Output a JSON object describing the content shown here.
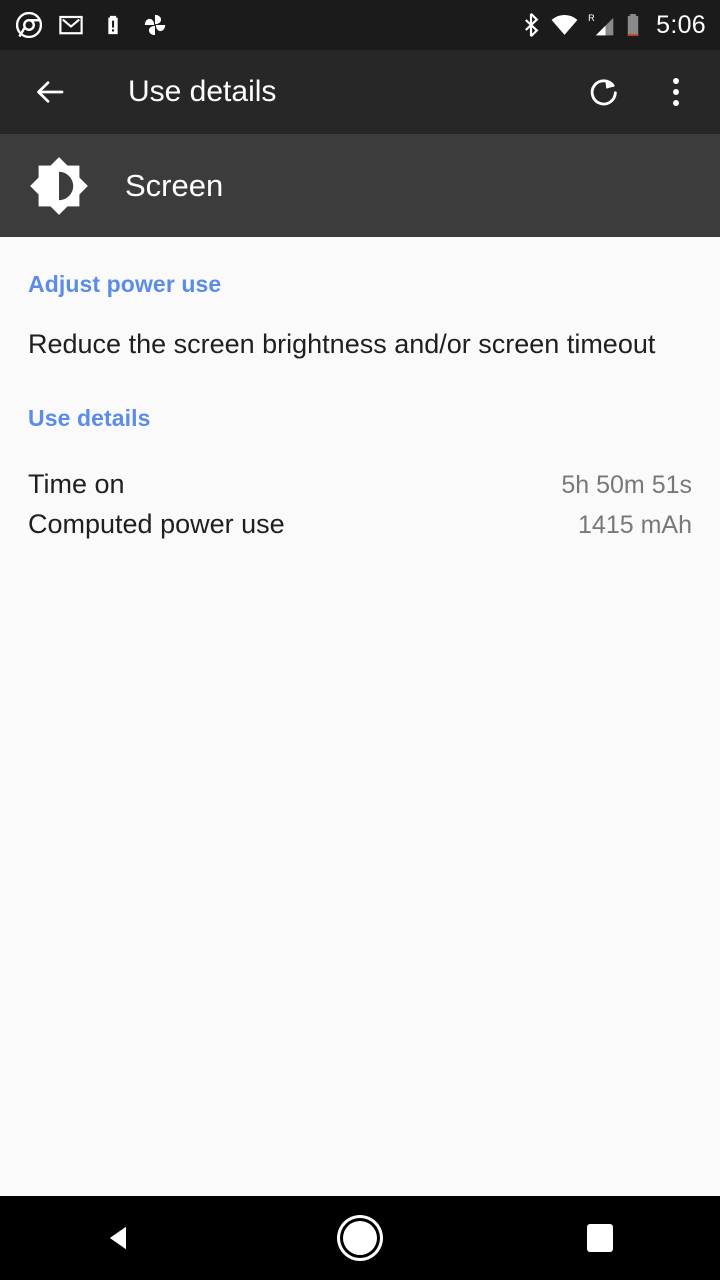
{
  "status_bar": {
    "time": "5:06",
    "left_icons": [
      {
        "name": "chrome-icon",
        "label": "Chrome"
      },
      {
        "name": "gmail-icon",
        "label": "Gmail"
      },
      {
        "name": "battery-alert-icon",
        "label": "Battery alert"
      },
      {
        "name": "google-photos-icon",
        "label": "Google Photos"
      }
    ],
    "right_icons": [
      {
        "name": "bluetooth-icon",
        "label": "Bluetooth"
      },
      {
        "name": "wifi-icon",
        "label": "Wi-Fi"
      },
      {
        "name": "cellular-signal-icon",
        "label": "Cellular signal",
        "roaming_badge": "R"
      },
      {
        "name": "battery-icon",
        "label": "Battery low"
      }
    ],
    "background": "#1b1b1b",
    "battery_warning_color": "#c1392b"
  },
  "toolbar": {
    "title": "Use details",
    "back_label": "Navigate up",
    "refresh_label": "Refresh",
    "overflow_label": "More options",
    "background": "#272727"
  },
  "app_header": {
    "title": "Screen",
    "icon": "brightness-icon",
    "background": "#3c3c3c"
  },
  "content": {
    "sections": [
      {
        "header": "Adjust power use",
        "body": "Reduce the screen brightness and/or screen timeout"
      },
      {
        "header": "Use details"
      }
    ],
    "details": [
      {
        "label": "Time on",
        "value": "5h 50m 51s"
      },
      {
        "label": "Computed power use",
        "value": "1415 mAh"
      }
    ],
    "header_color": "#5b8ce8",
    "background": "#fafafa"
  },
  "nav_bar": {
    "back_label": "Back",
    "home_label": "Home",
    "recents_label": "Recents",
    "background": "#000000"
  }
}
